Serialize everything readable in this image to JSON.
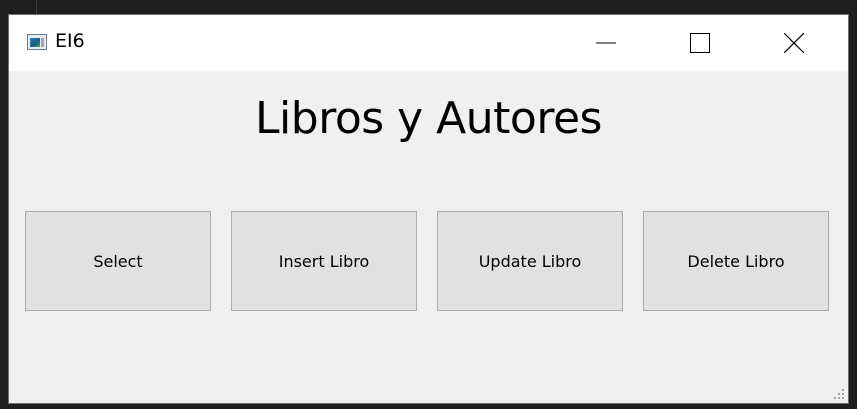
{
  "window": {
    "title": "EI6",
    "icon": "app-window-icon",
    "controls": {
      "minimize": "minimize-icon",
      "maximize": "maximize-icon",
      "close": "close-icon"
    }
  },
  "main": {
    "heading": "Libros y Autores",
    "buttons": [
      {
        "label": "Select"
      },
      {
        "label": "Insert Libro"
      },
      {
        "label": "Update Libro"
      },
      {
        "label": "Delete Libro"
      }
    ]
  },
  "colors": {
    "window_bg": "#f0f0f0",
    "titlebar_bg": "#ffffff",
    "button_bg": "#e1e1e1",
    "button_border": "#adadad"
  }
}
